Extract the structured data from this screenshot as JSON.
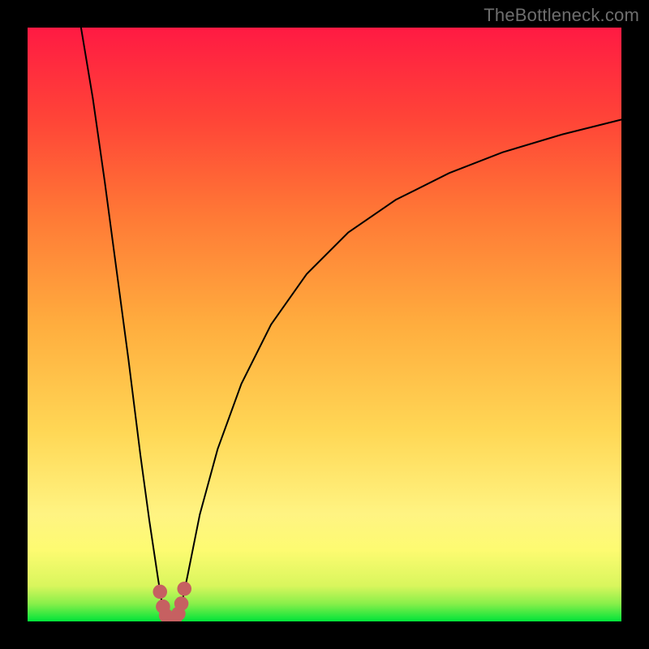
{
  "watermark": "TheBottleneck.com",
  "chart_data": {
    "type": "line",
    "title": "",
    "xlabel": "",
    "ylabel": "",
    "xlim": [
      0,
      100
    ],
    "ylim": [
      0,
      100
    ],
    "note": "No tick labels or axis labels are visible; x/y normalized to 0–100 percent of plot area (origin bottom-left). Values below are the plotted black curve sampled along x, plus red marker points around the curve minimum. Background is a vertical green→yellow→orange→red gradient.",
    "gradient_stops": [
      {
        "pos": 0.0,
        "color": "#00e43a"
      },
      {
        "pos": 0.03,
        "color": "#89ef4a"
      },
      {
        "pos": 0.06,
        "color": "#d9f65d"
      },
      {
        "pos": 0.12,
        "color": "#fdfb71"
      },
      {
        "pos": 0.18,
        "color": "#fff482"
      },
      {
        "pos": 0.32,
        "color": "#ffd755"
      },
      {
        "pos": 0.5,
        "color": "#ffad3e"
      },
      {
        "pos": 0.68,
        "color": "#ff7a36"
      },
      {
        "pos": 0.84,
        "color": "#ff4637"
      },
      {
        "pos": 1.0,
        "color": "#ff1a43"
      }
    ],
    "series": [
      {
        "name": "left-branch",
        "x": [
          9.0,
          11.0,
          13.0,
          15.0,
          17.0,
          19.0,
          20.5,
          22.0,
          23.0
        ],
        "y": [
          100.0,
          88.0,
          74.0,
          59.0,
          44.0,
          28.0,
          17.0,
          7.0,
          0.8
        ]
      },
      {
        "name": "right-branch",
        "x": [
          25.5,
          27.0,
          29.0,
          32.0,
          36.0,
          41.0,
          47.0,
          54.0,
          62.0,
          71.0,
          80.0,
          90.0,
          100.0
        ],
        "y": [
          0.8,
          8.0,
          18.0,
          29.0,
          40.0,
          50.0,
          58.5,
          65.5,
          71.0,
          75.5,
          79.0,
          82.0,
          84.5
        ]
      }
    ],
    "markers": {
      "name": "min-cluster",
      "color": "#c66061",
      "points": [
        {
          "x": 22.3,
          "y": 5.0
        },
        {
          "x": 22.8,
          "y": 2.5
        },
        {
          "x": 23.3,
          "y": 1.0
        },
        {
          "x": 24.0,
          "y": 0.5
        },
        {
          "x": 24.8,
          "y": 0.5
        },
        {
          "x": 25.4,
          "y": 1.3
        },
        {
          "x": 25.9,
          "y": 3.0
        },
        {
          "x": 26.4,
          "y": 5.5
        }
      ]
    }
  }
}
